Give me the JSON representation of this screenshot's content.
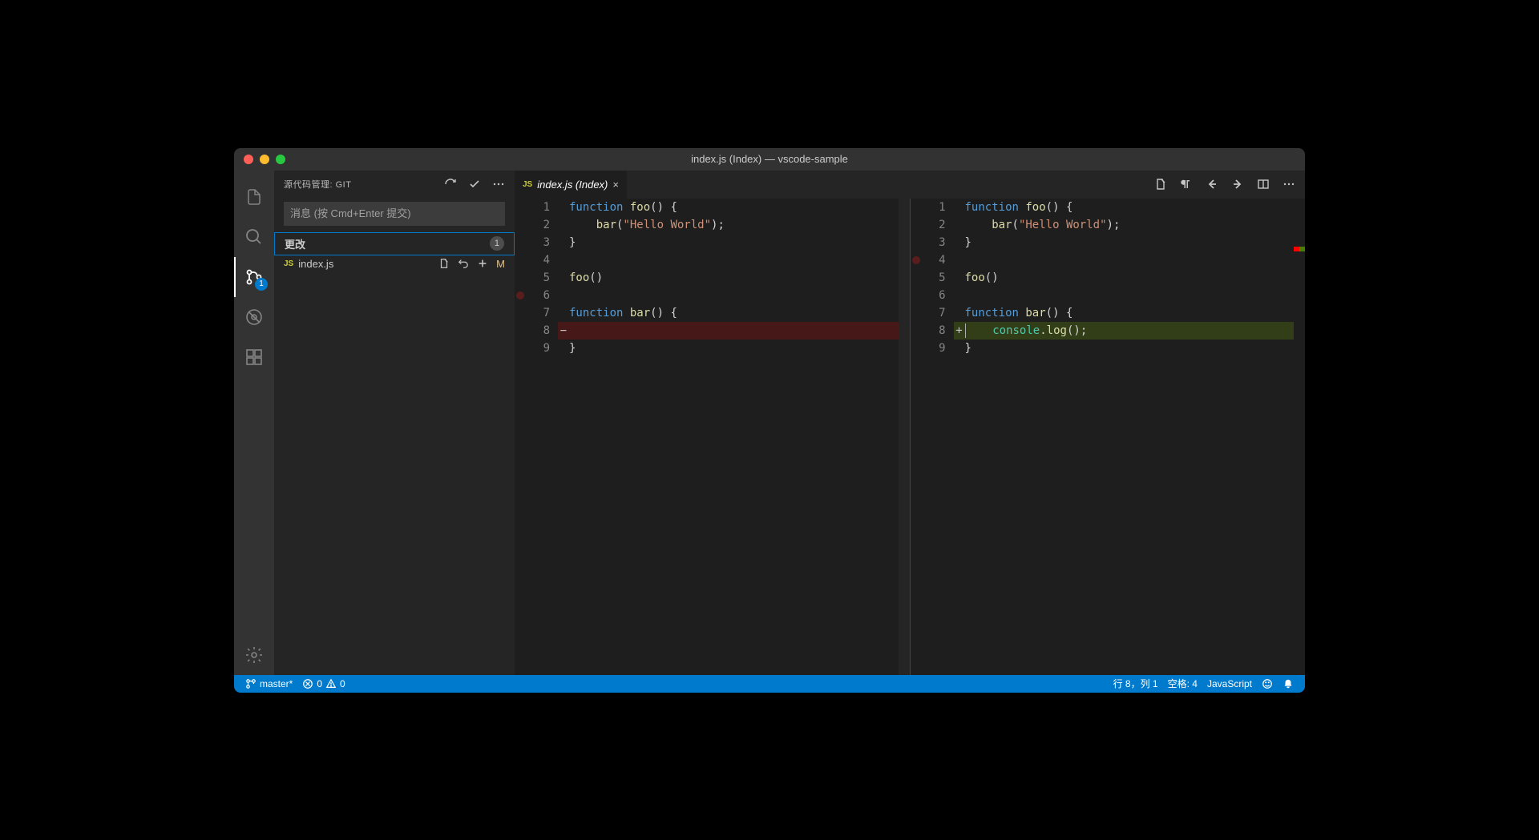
{
  "window": {
    "title": "index.js (Index) — vscode-sample"
  },
  "activity": {
    "scm_badge": "1"
  },
  "scm": {
    "header": "源代码管理: GIT",
    "commit_placeholder": "消息 (按 Cmd+Enter 提交)",
    "changes_label": "更改",
    "changes_count": "1",
    "file": {
      "badge": "JS",
      "name": "index.js",
      "status": "M"
    }
  },
  "tab": {
    "badge": "JS",
    "title": "index.js (Index)"
  },
  "diff": {
    "left": {
      "lines": [
        {
          "n": "1",
          "html": "<span class='kw'>function</span> <span class='fn'>foo</span>() {"
        },
        {
          "n": "2",
          "html": "    <span class='fn'>bar</span>(<span class='str'>\"Hello World\"</span>);"
        },
        {
          "n": "3",
          "html": "}"
        },
        {
          "n": "4",
          "html": ""
        },
        {
          "n": "5",
          "html": "<span class='fn'>foo</span>()"
        },
        {
          "n": "6",
          "html": "",
          "bp": true
        },
        {
          "n": "7",
          "html": "<span class='kw'>function</span> <span class='fn'>bar</span>() {"
        },
        {
          "n": "8",
          "html": "",
          "sign": "−",
          "cls": "removed"
        },
        {
          "n": "9",
          "html": "}"
        }
      ]
    },
    "right": {
      "lines": [
        {
          "n": "1",
          "html": "<span class='kw'>function</span> <span class='fn'>foo</span>() {"
        },
        {
          "n": "2",
          "html": "    <span class='fn'>bar</span>(<span class='str'>\"Hello World\"</span>);"
        },
        {
          "n": "3",
          "html": "}"
        },
        {
          "n": "4",
          "html": "",
          "bp": true
        },
        {
          "n": "5",
          "html": "<span class='fn'>foo</span>()"
        },
        {
          "n": "6",
          "html": ""
        },
        {
          "n": "7",
          "html": "<span class='kw'>function</span> <span class='fn'>bar</span>() {"
        },
        {
          "n": "8",
          "html": "    <span class='obj'>console</span>.<span class='fn'>log</span>();",
          "sign": "+",
          "cls": "added",
          "cursor": true
        },
        {
          "n": "9",
          "html": "}"
        }
      ]
    }
  },
  "status": {
    "branch": "master*",
    "errors": "0",
    "warnings": "0",
    "cursor": "行 8，列 1",
    "spaces": "空格: 4",
    "language": "JavaScript"
  }
}
